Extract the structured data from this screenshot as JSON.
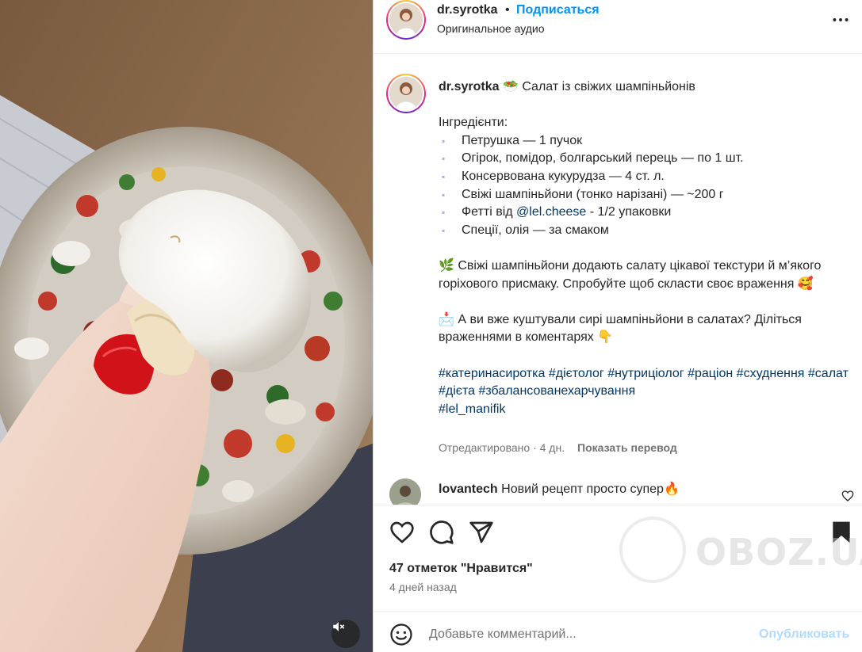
{
  "header": {
    "username": "dr.syrotka",
    "separator": "•",
    "follow_label": "Подписаться",
    "audio_label": "Оригинальное аудио"
  },
  "caption": {
    "username": "dr.syrotka",
    "title_emoji": "🥗",
    "title": "Салат із свіжих шампіньйонів",
    "ingredients_heading": "Інгредієнти:",
    "ingredients": [
      "Петрушка — 1 пучок",
      "Огірок, помідор, болгарський перець — по 1 шт.",
      "Консервована кукурудза — 4 ст. л.",
      "Свіжі шампіньйони (тонко нарізані) — ~200 г",
      "Фетті від ",
      "Спеції, олія — за смаком"
    ],
    "bullet": "▪",
    "fetti_link": "@lel.cheese",
    "fetti_suffix": " - 1/2 упаковки",
    "para1_emoji": "🌿",
    "para1": "Свіжі шампіньйони додають салату цікавої текстури й м’якого горіхового присмаку. Спробуйте щоб скласти своє враження",
    "para1_end_emoji": "🥰",
    "para2_emoji": "📩",
    "para2": "А ви вже куштували сирі шампіньйони в салатах? Діліться враженнями в коментарях",
    "para2_end_emoji": "👇",
    "hashtags": [
      "#катеринасиротка",
      "#дієтолог",
      "#нутриціолог",
      "#раціон",
      "#схуднення",
      "#салат",
      "#дієта",
      "#збалансованехарчування",
      "#lel_manifik"
    ],
    "edited_label": "Отредактировано · 4 дн.",
    "translate_label": "Показать перевод"
  },
  "comment": {
    "username": "lovantech",
    "text": "Новий рецепт просто супер",
    "emoji": "🔥"
  },
  "actions": {
    "likes": "47 отметок \"Нравится\"",
    "date": "4 дней назад"
  },
  "comment_box": {
    "placeholder": "Добавьте комментарий...",
    "publish_label": "Опубликовать"
  },
  "watermark": {
    "text": "OBOZ.UA"
  },
  "icons": {
    "more": "more-horizontal-icon",
    "like": "heart-icon",
    "comment": "comment-icon",
    "share": "send-icon",
    "save": "bookmark-icon",
    "emoji": "smiley-icon",
    "mute": "muted-speaker-icon"
  },
  "colors": {
    "accent": "#0095f6",
    "link": "#00376b",
    "publish_disabled": "#b3dbff",
    "muted_text": "#737373"
  }
}
